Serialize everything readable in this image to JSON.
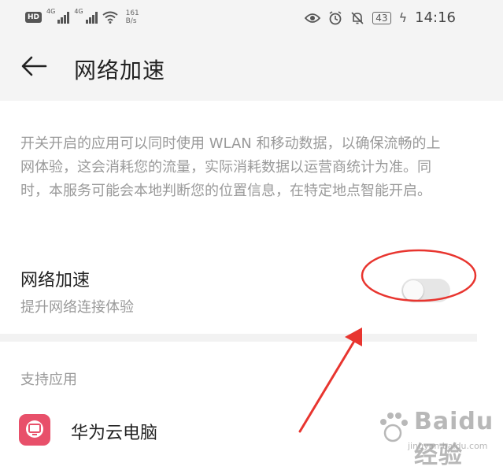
{
  "status_bar": {
    "hd_badge": "HD",
    "network_tag_1": "4G",
    "network_tag_2": "4G",
    "speed_value": "161",
    "speed_unit": "B/s",
    "battery": "43",
    "time": "14:16",
    "icons": [
      "hd-icon",
      "signal-icon",
      "signal-icon",
      "wifi-icon",
      "eye-icon",
      "alarm-icon",
      "bell-mute-icon",
      "battery-icon",
      "charging-icon"
    ]
  },
  "app_bar": {
    "title": "网络加速",
    "back_icon": "back-arrow-icon"
  },
  "description": "开关开启的应用可以同时使用 WLAN 和移动数据，以确保流畅的上网体验，这会消耗您的流量，实际消耗数据以运营商统计为准。同时，本服务可能会本地判断您的位置信息，在特定地点智能开启。",
  "setting": {
    "title": "网络加速",
    "subtitle": "提升网络连接体验",
    "toggle_on": false
  },
  "supported_apps": {
    "header": "支持应用",
    "items": [
      {
        "label": "华为云电脑",
        "icon": "cloud-pc-icon"
      }
    ]
  },
  "annotation": {
    "color": "#e8352f",
    "shapes": [
      "ellipse-highlight",
      "arrow-pointer"
    ]
  },
  "watermark": {
    "text": "Baidu经验",
    "sub": "jingyan.baidu.com"
  },
  "colors": {
    "appbar_bg": "#f4f4f4",
    "secondary_text": "#9a9a9a",
    "app_icon": "#e8506a"
  }
}
